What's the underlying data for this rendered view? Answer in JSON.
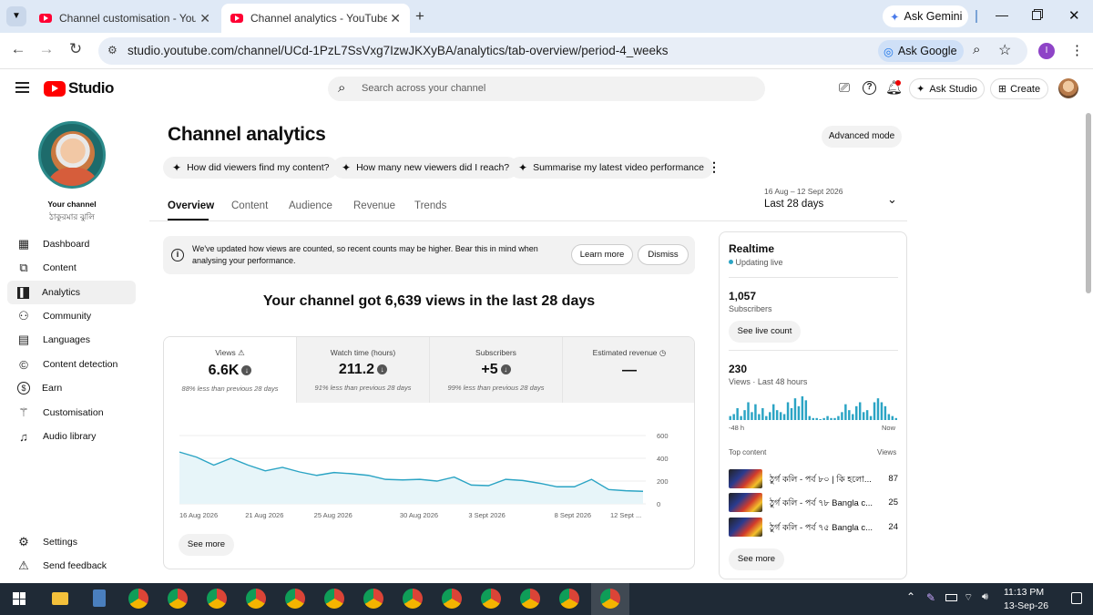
{
  "browser": {
    "tabs": [
      {
        "title": "Channel customisation - YouTube Studio"
      },
      {
        "title": "Channel analytics - YouTube Studio"
      }
    ],
    "new_tab_symbol": "+",
    "ask_gemini": "Ask Gemini",
    "url": "studio.youtube.com/channel/UCd-1PzL7SsVxg7IzwJKXyBA/analytics/tab-overview/period-4_weeks",
    "ask_google": "Ask Google",
    "profile_initial": "I"
  },
  "studio": {
    "logo_text": "Studio",
    "search_placeholder": "Search across your channel",
    "ask_studio": "Ask Studio",
    "create": "Create"
  },
  "sidebar": {
    "your_channel": "Your channel",
    "channel_name": "ঠাকুরমার ঝুলি",
    "items": [
      {
        "label": "Dashboard",
        "icon": "dashboard-icon"
      },
      {
        "label": "Content",
        "icon": "content-icon"
      },
      {
        "label": "Analytics",
        "icon": "analytics-icon"
      },
      {
        "label": "Community",
        "icon": "community-icon"
      },
      {
        "label": "Languages",
        "icon": "languages-icon"
      },
      {
        "label": "Content detection",
        "icon": "copyright-icon"
      },
      {
        "label": "Earn",
        "icon": "dollar-icon"
      },
      {
        "label": "Customisation",
        "icon": "magic-wand-icon"
      },
      {
        "label": "Audio library",
        "icon": "audio-library-icon"
      }
    ],
    "settings": "Settings",
    "feedback": "Send feedback"
  },
  "main": {
    "title": "Channel analytics",
    "advanced_mode": "Advanced mode",
    "chips": [
      "How did viewers find my content?",
      "How many new viewers did I reach?",
      "Summarise my latest video performance"
    ],
    "tabs": [
      "Overview",
      "Content",
      "Audience",
      "Revenue",
      "Trends"
    ],
    "period_range": "16 Aug – 12 Sept 2026",
    "period_label": "Last 28 days",
    "notice_text": "We've updated how views are counted, so recent counts may be higher. Bear this in mind when analysing your performance.",
    "learn_more": "Learn more",
    "dismiss": "Dismiss",
    "headline": "Your channel got 6,639 views in the last 28 days",
    "metrics": [
      {
        "label": "Views",
        "value": "6.6K",
        "sub": "88% less than previous 28 days"
      },
      {
        "label": "Watch time (hours)",
        "value": "211.2",
        "sub": "91% less than previous 28 days"
      },
      {
        "label": "Subscribers",
        "value": "+5",
        "sub": "99% less than previous 28 days"
      },
      {
        "label": "Estimated revenue",
        "value": "—",
        "sub": ""
      }
    ],
    "see_more": "See more"
  },
  "chart_data": {
    "type": "area",
    "x": [
      "16 Aug 2026",
      "17",
      "18",
      "19",
      "20",
      "21 Aug 2026",
      "22",
      "23",
      "24",
      "25 Aug 2026",
      "26",
      "27",
      "28",
      "29",
      "30 Aug 2026",
      "31",
      "1",
      "2",
      "3 Sept 2026",
      "4",
      "5",
      "6",
      "7",
      "8 Sept 2026",
      "9",
      "10",
      "11",
      "12 Sept 2026"
    ],
    "x_tick_labels": [
      "16 Aug 2026",
      "21 Aug 2026",
      "25 Aug 2026",
      "30 Aug 2026",
      "3 Sept 2026",
      "8 Sept 2026",
      "12 Sept ..."
    ],
    "values": [
      455,
      410,
      340,
      400,
      340,
      290,
      320,
      280,
      250,
      275,
      265,
      250,
      215,
      210,
      215,
      200,
      235,
      165,
      160,
      215,
      205,
      180,
      150,
      150,
      215,
      125,
      115,
      110
    ],
    "y_ticks": [
      "0",
      "200",
      "400",
      "600"
    ],
    "ylim": [
      0,
      600
    ],
    "color": "#2ba4c4"
  },
  "realtime": {
    "title": "Realtime",
    "status": "Updating live",
    "subscribers_value": "1,057",
    "subscribers_label": "Subscribers",
    "see_live": "See live count",
    "views_value": "230",
    "views_label": "Views · Last 48 hours",
    "bars": [
      2,
      3,
      6,
      2,
      5,
      9,
      4,
      8,
      3,
      6,
      2,
      4,
      8,
      5,
      4,
      3,
      9,
      6,
      11,
      7,
      12,
      10,
      2,
      1,
      1,
      0,
      1,
      2,
      1,
      1,
      2,
      4,
      8,
      5,
      3,
      7,
      9,
      4,
      5,
      2,
      9,
      11,
      9,
      7,
      3,
      2,
      1
    ],
    "axis_start": "-48 h",
    "axis_end": "Now",
    "top_content_label": "Top content",
    "views_col": "Views",
    "top_content": [
      {
        "title": "ঠুর্গ কলি - পর্ব ৮০ | কি হলো...",
        "views": "87"
      },
      {
        "title": "ঠুর্গ কলি - পর্ব ৭৮ Bangla c...",
        "views": "25"
      },
      {
        "title": "ঠুর্গ কলি - পর্ব ৭৫ Bangla c...",
        "views": "24"
      }
    ],
    "see_more": "See more"
  },
  "taskbar": {
    "time": "11:13 PM",
    "date": "13-Sep-26"
  }
}
